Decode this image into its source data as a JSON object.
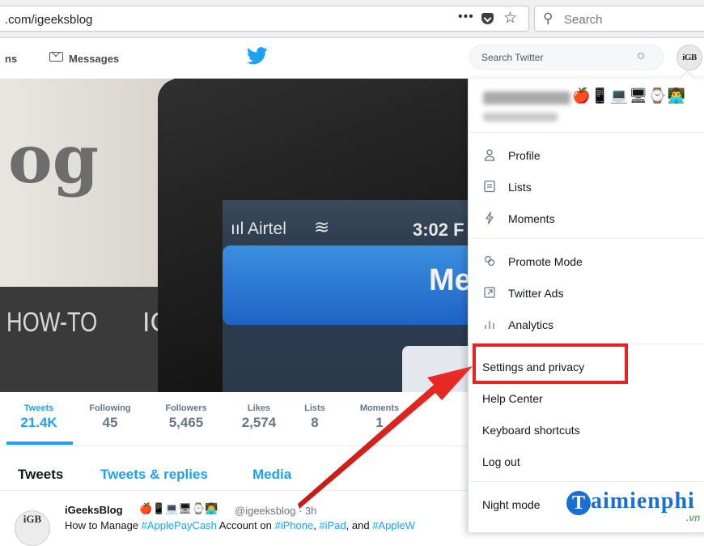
{
  "browser": {
    "url": ".com/igeeksblog",
    "more_label": "•••",
    "search_placeholder": "Search"
  },
  "twitter_nav": {
    "notifications_partial": "ns",
    "messages_label": "Messages",
    "search_placeholder": "Search Twitter",
    "avatar_text": "iGB"
  },
  "cover": {
    "paper_text": "og",
    "howto_text": "HOW-TO",
    "ic_text": "IC",
    "carrier": "ııl Airtel",
    "clock": "3:02 F",
    "banner_text": "Me"
  },
  "stats": [
    {
      "label": "Tweets",
      "value": "21.4K"
    },
    {
      "label": "Following",
      "value": "45"
    },
    {
      "label": "Followers",
      "value": "5,465"
    },
    {
      "label": "Likes",
      "value": "2,574"
    },
    {
      "label": "Lists",
      "value": "8"
    },
    {
      "label": "Moments",
      "value": "1"
    }
  ],
  "tabs": {
    "tweets": "Tweets",
    "replies": "Tweets & replies",
    "media": "Media"
  },
  "tweet": {
    "avatar_text": "iGB",
    "author": "iGeeksBlog",
    "emoji": "🍎📱💻🖥⌚👨‍💻",
    "handle_time": "@igeeksblog · 3h",
    "snippet_start": "How to Manage ",
    "tag1": "#ApplePayCash",
    "snippet_mid": " Account on ",
    "tag2": "#iPhone",
    "snippet_sep": ", ",
    "tag3": "#iPad",
    "snippet_and": ", and ",
    "tag4": "#AppleW"
  },
  "dropdown": {
    "emoji": "🍎📱💻🖥⌚👨‍💻",
    "items": [
      {
        "label": "Profile",
        "icon": "person-icon"
      },
      {
        "label": "Lists",
        "icon": "lists-icon"
      },
      {
        "label": "Moments",
        "icon": "lightning-icon"
      },
      {
        "label": "Promote Mode",
        "icon": "promote-icon"
      },
      {
        "label": "Twitter Ads",
        "icon": "external-link-icon"
      },
      {
        "label": "Analytics",
        "icon": "bar-chart-icon"
      },
      {
        "label": "Settings and privacy"
      },
      {
        "label": "Help Center"
      },
      {
        "label": "Keyboard shortcuts"
      },
      {
        "label": "Log out"
      },
      {
        "label": "Night mode"
      }
    ]
  },
  "watermark": {
    "letter": "T",
    "text": "aimienphi",
    "suffix": ".vn"
  },
  "colors": {
    "twitter_blue": "#1da1f2",
    "highlight_red": "#e8231f",
    "watermark_blue": "#1a6fd6"
  }
}
